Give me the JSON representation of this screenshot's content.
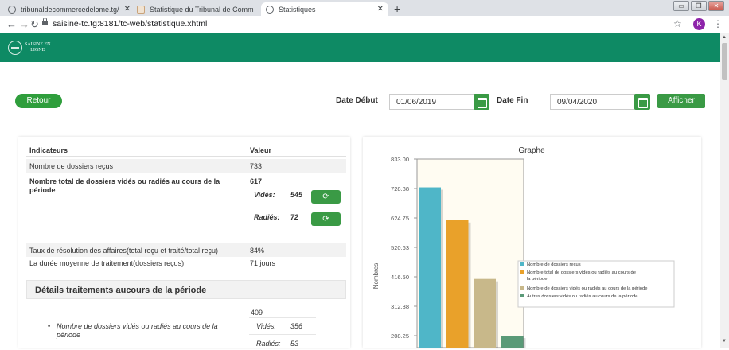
{
  "browser": {
    "tabs": [
      {
        "title": "tribunaldecommercedelome.tg/",
        "active": false
      },
      {
        "title": "Statistique du Tribunal de Comm",
        "active": false
      },
      {
        "title": "Statistiques",
        "active": true
      }
    ],
    "url": "saisine-tc.tg:8181/tc-web/statistique.xhtml",
    "profile_initial": "K"
  },
  "header": {
    "logo_line1": "SAISINE EN",
    "logo_line2": "LIGNE",
    "color": "#0e8a64"
  },
  "controls": {
    "retour_label": "Retour",
    "date_debut_label": "Date Début",
    "date_debut_value": "01/06/2019",
    "date_fin_label": "Date Fin",
    "date_fin_value": "09/04/2020",
    "afficher_label": "Afficher"
  },
  "table": {
    "headers": [
      "Indicateurs",
      "Valeur"
    ],
    "rows": [
      {
        "label": "Nombre de dossiers reçus",
        "value": "733"
      },
      {
        "label": "Nombre total de dossiers vidés ou radiés au cours de la période",
        "value": "617"
      },
      {
        "label": "Taux de résolution des affaires(total reçu et traité/total reçu)",
        "value": "84%"
      },
      {
        "label": "La durée moyenne de traitement(dossiers reçus)",
        "value": "71 jours"
      }
    ],
    "sub": {
      "vides_label": "Vidés:",
      "vides_value": "545",
      "radies_label": "Radiés:",
      "radies_value": "72"
    }
  },
  "details": {
    "title": "Détails traitements aucours de la période",
    "total": "409",
    "item_text": "Nombre de dossiers vidés ou radiés au cours de la période",
    "vides_label": "Vidés:",
    "vides_value": "356",
    "radies_label": "Radiés:",
    "radies_value": "53"
  },
  "chart_data": {
    "type": "bar",
    "title": "Graphe",
    "ylabel": "Nombres",
    "ytick_labels": [
      "833.00",
      "728.88",
      "624.75",
      "520.63",
      "416.50",
      "312.38",
      "208.25"
    ],
    "series": [
      {
        "name": "Nombre de dossiers reçus",
        "value": 733,
        "color": "#4fb6c8"
      },
      {
        "name": "Nombre total de dossiers vidés ou radiés au cours de la période",
        "value": 617,
        "color": "#e9a12a"
      },
      {
        "name": "Nombre de dossiers vidés ou radiés au cours de la période",
        "value": 409,
        "color": "#c8b88a"
      },
      {
        "name": "Autres dossiers vidés ou radiés au cours de la période",
        "value": 208,
        "color": "#5a9a78"
      }
    ]
  }
}
